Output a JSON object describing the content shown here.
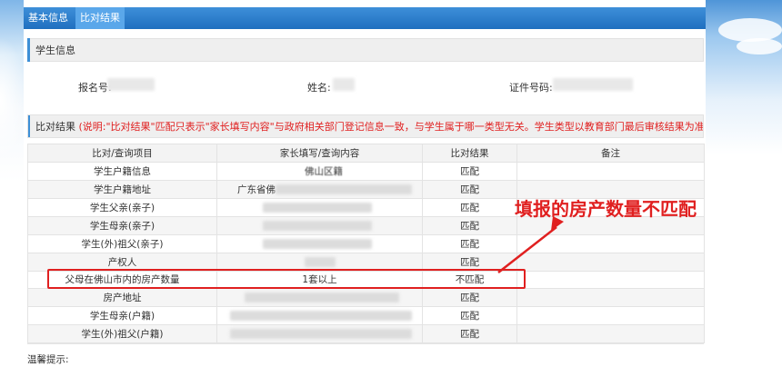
{
  "tabs": [
    {
      "label": "基本信息",
      "active": false
    },
    {
      "label": "比对结果",
      "active": true
    }
  ],
  "student_info": {
    "title": "学生信息",
    "fields": [
      {
        "label": "报名号:"
      },
      {
        "label": "姓名:"
      },
      {
        "label": "证件号码:"
      }
    ]
  },
  "comparison": {
    "title": "比对结果",
    "note_prefix": "(说明:",
    "note_text": "\"比对结果\"匹配只表示\"家长填写内容\"与政府相关部门登记信息一致，与学生属于哪一类型无关。学生类型以教育部门最后审核结果为准。)",
    "headers": [
      "比对/查询项目",
      "家长填写/查询内容",
      "比对结果",
      "备注"
    ],
    "rows": [
      {
        "item": "学生户籍信息",
        "content": "佛山区籍",
        "result": "匹配",
        "remark": ""
      },
      {
        "item": "学生户籍地址",
        "content": "广东省佛",
        "result": "匹配",
        "remark": ""
      },
      {
        "item": "学生父亲(亲子)",
        "content": "",
        "result": "匹配",
        "remark": ""
      },
      {
        "item": "学生母亲(亲子)",
        "content": "",
        "result": "匹配",
        "remark": ""
      },
      {
        "item": "学生(外)祖父(亲子)",
        "content": "",
        "result": "匹配",
        "remark": ""
      },
      {
        "item": "产权人",
        "content": "",
        "result": "匹配",
        "remark": ""
      },
      {
        "item": "父母在佛山市内的房产数量",
        "content": "1套以上",
        "result": "不匹配",
        "remark": ""
      },
      {
        "item": "房产地址",
        "content": "",
        "result": "匹配",
        "remark": ""
      },
      {
        "item": "学生母亲(户籍)",
        "content": "",
        "result": "匹配",
        "remark": ""
      },
      {
        "item": "学生(外)祖父(户籍)",
        "content": "",
        "result": "匹配",
        "remark": ""
      }
    ]
  },
  "annotation": {
    "text": "填报的房产数量不匹配",
    "color": "#e02020"
  },
  "footer": {
    "tip": "温馨提示:"
  },
  "colors": {
    "tab_bar": "#2a7fd0",
    "match": "#1e9a1e",
    "nomatch": "#e02020"
  }
}
